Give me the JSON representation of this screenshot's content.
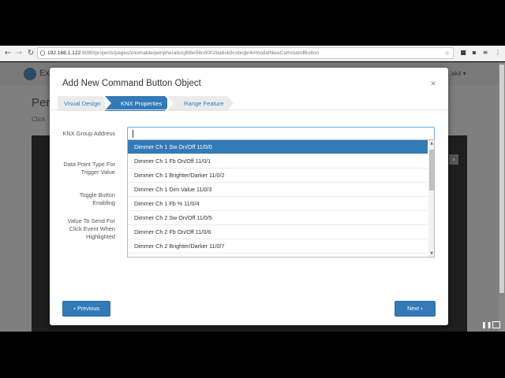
{
  "browser": {
    "url_host": "192.168.1.122",
    "url_rest": ":8080/projects/pages/zoomable/peripherals/cj8t6e56n0002ba6sk9csbrqb/4#modalNewCommandButton",
    "back_glyph": "←",
    "forward_glyph": "→",
    "reload_glyph": "↻",
    "star_glyph": "☆",
    "ext_glyphs": [
      "■",
      "▪",
      "≡",
      "⋮"
    ]
  },
  "page": {
    "app_name": "Ex",
    "title": "Per",
    "subtitle": "Click",
    "user_menu": "akit ▾",
    "panel_arrow": "›"
  },
  "modal": {
    "title": "Add New Command Button Object",
    "close": "×",
    "steps": [
      {
        "label": "Visual Design",
        "active": false
      },
      {
        "label": "KNX Properties",
        "active": true
      },
      {
        "label": "Range Feature",
        "active": false
      }
    ],
    "fields": {
      "group_address": "KNX Group Address",
      "dpt": "Data Point Type For Trigger Value",
      "toggle": "Toggle Button Enabling",
      "value": "Value To Send For Click Event When Highlighted"
    },
    "group_input_value": "",
    "dropdown": {
      "items": [
        "Dimmer Ch 1 Sw On/Off 11/0/0",
        "Dimmer Ch 1 Fb On/Off 11/0/1",
        "Dimmer Ch 1 Brighter/Darker 11/0/2",
        "Dimmer Ch 1 Dim Value 11/0/3",
        "Dimmer Ch 1 Fb % 11/0/4",
        "Dimmer Ch 2 Sw On/Off 11/0/5",
        "Dimmer Ch 2 Fb On/Off 11/0/6",
        "Dimmer Ch 2 Brighter/Darker 11/0/7"
      ],
      "selected_index": 0,
      "scroll_up": "▲",
      "scroll_down": "▼"
    },
    "buttons": {
      "previous": "Previous",
      "previous_icon": "‹",
      "next": "Next",
      "next_icon": "›"
    }
  },
  "colors": {
    "primary": "#337ab7",
    "step_inactive": "#ebebeb"
  }
}
